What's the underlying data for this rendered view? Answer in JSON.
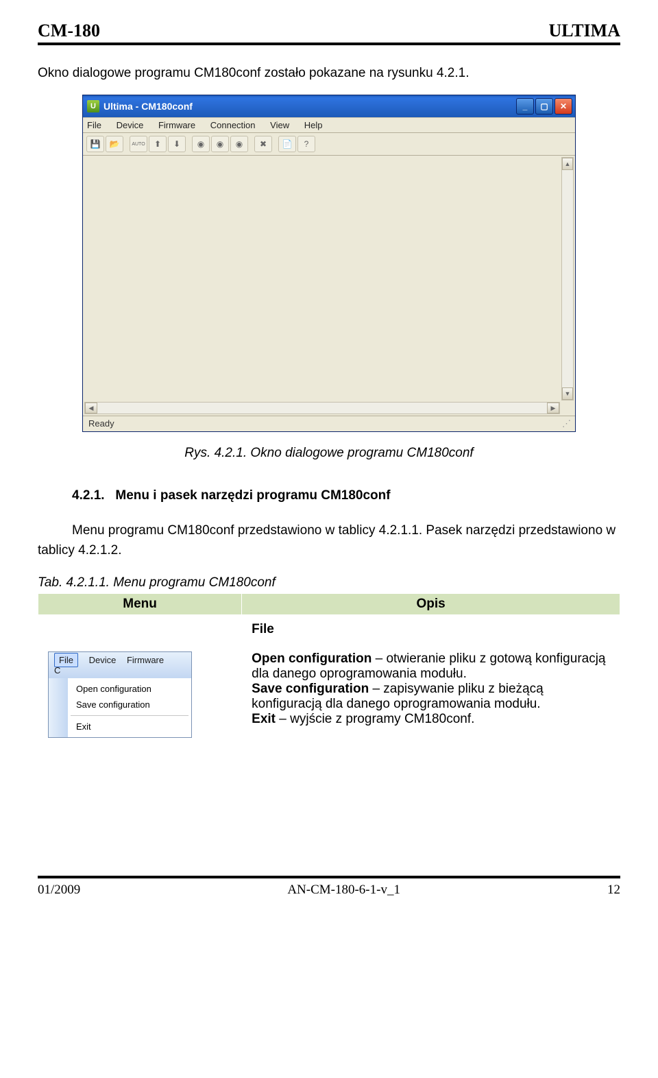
{
  "header": {
    "left": "CM-180",
    "right": "ULTIMA"
  },
  "intro": "Okno dialogowe programu CM180conf zostało pokazane na rysunku 4.2.1.",
  "window": {
    "title": "Ultima - CM180conf",
    "menu": [
      "File",
      "Device",
      "Firmware",
      "Connection",
      "View",
      "Help"
    ],
    "status": "Ready"
  },
  "fig_caption": "Rys. 4.2.1. Okno dialogowe programu CM180conf",
  "section": {
    "num": "4.2.1.",
    "title": "Menu i pasek narzędzi programu CM180conf",
    "para": "Menu programu CM180conf przedstawiono w tablicy 4.2.1.1. Pasek narzędzi przedstawiono w tablicy 4.2.1.2."
  },
  "table": {
    "caption": "Tab. 4.2.1.1. Menu programu CM180conf",
    "col_menu": "Menu",
    "col_opis": "Opis",
    "file_label": "File",
    "file_menu_tabs": [
      "File",
      "Device",
      "Firmware",
      "C"
    ],
    "file_items": [
      "Open configuration",
      "Save configuration",
      "Exit"
    ],
    "desc_open_b": "Open configuration",
    "desc_open": " – otwieranie pliku z gotową konfiguracją dla danego oprogramowania modułu.",
    "desc_save_b": "Save configuration",
    "desc_save": " – zapisywanie pliku z bieżącą konfiguracją dla danego oprogramowania modułu.",
    "desc_exit_b": "Exit",
    "desc_exit": " – wyjście z programy CM180conf."
  },
  "footer": {
    "left": "01/2009",
    "center": "AN-CM-180-6-1-v_1",
    "right": "12"
  }
}
